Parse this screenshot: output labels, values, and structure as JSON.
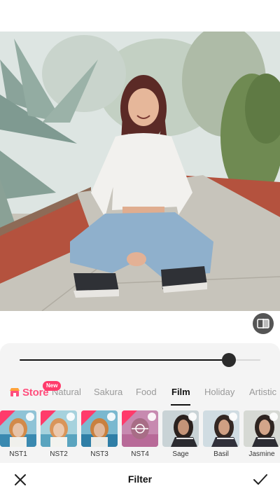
{
  "editor": {
    "photo_alt": "Edited photo preview",
    "compare_icon": "compare-icon"
  },
  "slider": {
    "value": 0.87
  },
  "store": {
    "label": "Store",
    "badge": "New",
    "icon": "store-icon"
  },
  "categories": [
    {
      "label": "Natural",
      "active": false
    },
    {
      "label": "Sakura",
      "active": false
    },
    {
      "label": "Food",
      "active": false
    },
    {
      "label": "Film",
      "active": true
    },
    {
      "label": "Holiday",
      "active": false
    },
    {
      "label": "Artistic",
      "active": false
    }
  ],
  "filters": [
    {
      "label": "NST1",
      "badge": "New"
    },
    {
      "label": "NST2",
      "badge": "New"
    },
    {
      "label": "NST3",
      "badge": "New"
    },
    {
      "label": "NST4",
      "badge": "New"
    },
    {
      "label": "Sage",
      "badge": ""
    },
    {
      "label": "Basil",
      "badge": ""
    },
    {
      "label": "Jasmine",
      "badge": ""
    }
  ],
  "bottom_bar": {
    "title": "Filter",
    "cancel_icon": "close-icon",
    "confirm_icon": "checkmark-icon"
  },
  "colors": {
    "accent": "#ff4f7d",
    "badge": "#ff3b6b"
  }
}
